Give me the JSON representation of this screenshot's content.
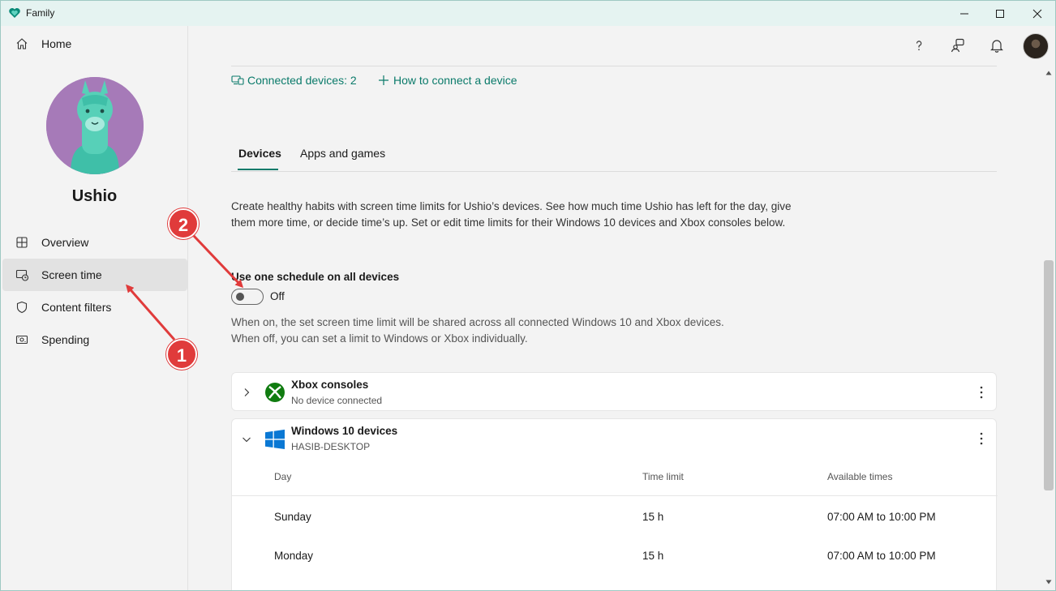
{
  "window": {
    "title": "Family",
    "accent": "#0a7a6a"
  },
  "sidebar": {
    "home_label": "Home",
    "user_name": "Ushio",
    "items": [
      {
        "label": "Overview",
        "icon": "overview-icon"
      },
      {
        "label": "Screen time",
        "icon": "screen-time-icon",
        "active": true
      },
      {
        "label": "Content filters",
        "icon": "shield-icon"
      },
      {
        "label": "Spending",
        "icon": "spending-icon"
      }
    ]
  },
  "header": {
    "icons": [
      "help-icon",
      "family-connect-icon",
      "bell-icon",
      "profile-avatar"
    ]
  },
  "links": {
    "connected": "Connected devices: 2",
    "how_to": "How to connect a device"
  },
  "tabs": [
    {
      "label": "Devices",
      "active": true
    },
    {
      "label": "Apps and games",
      "active": false
    }
  ],
  "description": "Create healthy habits with screen time limits for Ushio’s devices. See how much time Ushio has left for the day, give them more time, or decide time’s up. Set or edit time limits for their Windows 10 devices and Xbox consoles below.",
  "schedule": {
    "title": "Use one schedule on all devices",
    "toggle_state": "Off",
    "note_line1": "When on, the set screen time limit will be shared across all connected Windows 10 and Xbox devices.",
    "note_line2": "When off, you can set a limit to Windows or Xbox individually."
  },
  "xbox_card": {
    "title": "Xbox consoles",
    "subtitle": "No device connected"
  },
  "windows_card": {
    "title": "Windows 10 devices",
    "subtitle": "HASIB-DESKTOP",
    "columns": [
      "Day",
      "Time limit",
      "Available times"
    ],
    "rows": [
      {
        "day": "Sunday",
        "limit": "15 h",
        "times": "07:00 AM to 10:00 PM"
      },
      {
        "day": "Monday",
        "limit": "15 h",
        "times": "07:00 AM to 10:00 PM"
      }
    ]
  },
  "annotations": {
    "badge1": "1",
    "badge2": "2",
    "color": "#e03b3b"
  }
}
